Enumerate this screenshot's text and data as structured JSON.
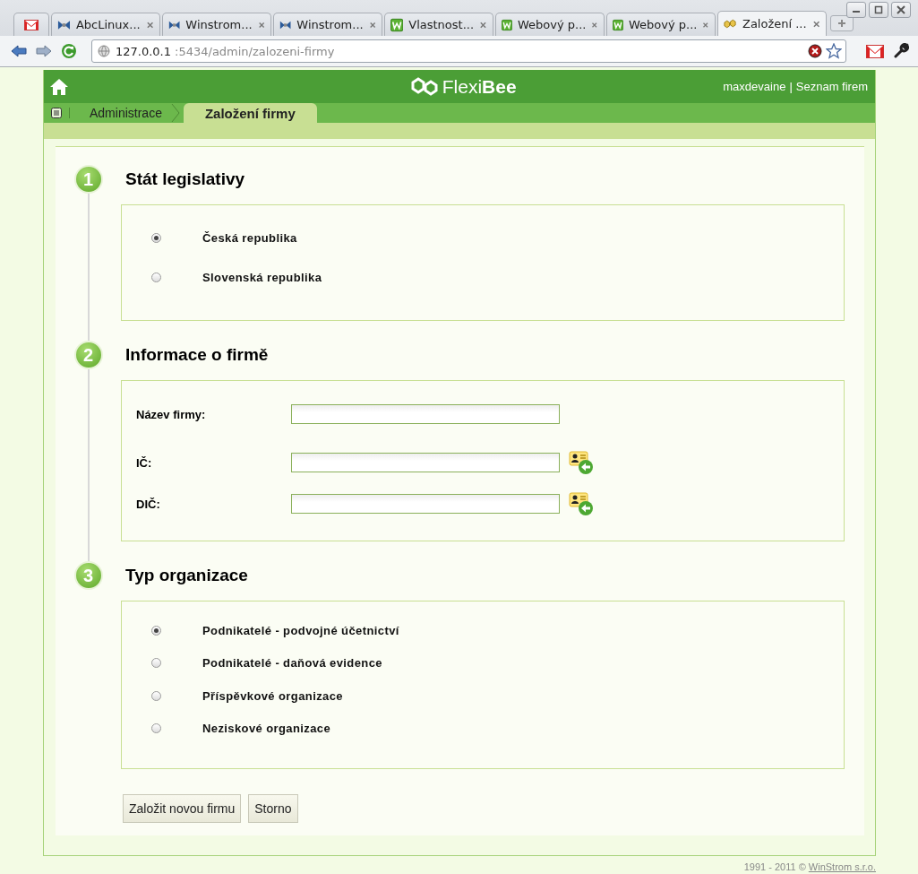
{
  "browser": {
    "tabs": [
      {
        "kind": "gmail",
        "selected": false
      },
      {
        "kind": "winstrom",
        "title": "AbcLinux...",
        "selected": false
      },
      {
        "kind": "winstrom",
        "title": "Winstrom...",
        "selected": false
      },
      {
        "kind": "winstrom",
        "title": "Winstrom...",
        "selected": false
      },
      {
        "kind": "w",
        "title": "Vlastnost...",
        "selected": false
      },
      {
        "kind": "w",
        "title": "Webový p...",
        "selected": false
      },
      {
        "kind": "w",
        "title": "Webový p...",
        "selected": false
      },
      {
        "kind": "flexibee",
        "title": "Založení ...",
        "selected": true
      }
    ],
    "address": {
      "host": "127.0.0.1",
      "path": ":5434/admin/zalozeni-firmy"
    }
  },
  "header": {
    "logo": "Flexi**Bee**",
    "user": "maxdevaine",
    "separator": "|",
    "companies_link": "Seznam firem"
  },
  "breadcrumb": [
    {
      "label": "Administrace",
      "selected": false
    },
    {
      "label": "Založení firmy",
      "selected": true
    }
  ],
  "sections": [
    {
      "number": "1",
      "title": "Stát legislativy",
      "kind": "radios",
      "options": [
        {
          "label": "Česká republika",
          "selected": true
        },
        {
          "label": "Slovenská republika",
          "selected": false
        }
      ]
    },
    {
      "number": "2",
      "title": "Informace o firmě",
      "kind": "fields",
      "fields": [
        {
          "label": "Název firmy:",
          "lookup": false
        },
        {
          "label": "IČ:",
          "lookup": true
        },
        {
          "label": "DIČ:",
          "lookup": true
        }
      ]
    },
    {
      "number": "3",
      "title": "Typ organizace",
      "kind": "radios",
      "options": [
        {
          "label": "Podnikatelé - podvojné účetnictví",
          "selected": true
        },
        {
          "label": "Podnikatelé - daňová evidence",
          "selected": false
        },
        {
          "label": "Příspěvkové organizace",
          "selected": false
        },
        {
          "label": "Neziskové organizace",
          "selected": false
        }
      ]
    }
  ],
  "buttons": [
    "Založit novou firmu",
    "Storno"
  ],
  "footer": {
    "text": "1991 - 2011 © ",
    "link": "WinStrom s.r.o."
  }
}
